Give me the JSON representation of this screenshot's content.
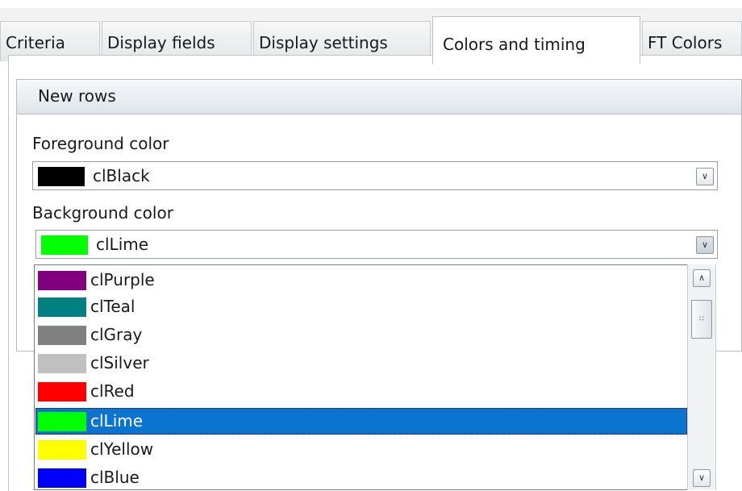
{
  "tabs": [
    "Criteria",
    "Display fields",
    "Display settings",
    "Colors and timing",
    "FT Colors"
  ],
  "active_tab": "Colors and timing",
  "group": {
    "title": "New rows"
  },
  "foreground": {
    "label": "Foreground color",
    "value": "clBlack",
    "color": "#000000"
  },
  "background": {
    "label": "Background color",
    "value": "clLime",
    "color": "#00ff00"
  },
  "dropdown_items": [
    {
      "label": "clPurple",
      "color": "#800080"
    },
    {
      "label": "clTeal",
      "color": "#008080"
    },
    {
      "label": "clGray",
      "color": "#808080"
    },
    {
      "label": "clSilver",
      "color": "#c0c0c0"
    },
    {
      "label": "clRed",
      "color": "#ff0000"
    },
    {
      "label": "clLime",
      "color": "#00ff00",
      "selected": true
    },
    {
      "label": "clYellow",
      "color": "#ffff00"
    },
    {
      "label": "clBlue",
      "color": "#0000ff"
    }
  ],
  "icons": {
    "dropdown": "chevron-down-icon",
    "scroll_up": "chevron-up-icon",
    "scroll_down": "chevron-down-icon",
    "thumb_grip": "grip-icon"
  },
  "colors": {
    "selection": "#0b74d0"
  }
}
